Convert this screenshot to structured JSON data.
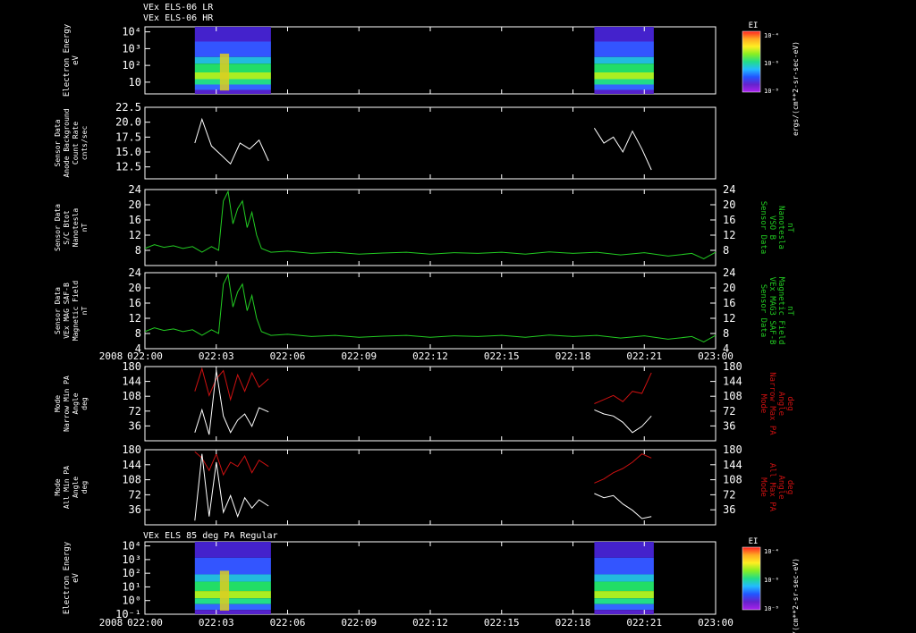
{
  "header": {
    "line1": "VEx ELS-06 LR",
    "line2": "VEx ELS-06 HR"
  },
  "bottom_header": "VEx ELS 85 deg PA Regular",
  "year_label": "2008",
  "time_ticks": [
    "022:00",
    "022:03",
    "022:06",
    "022:09",
    "022:12",
    "022:15",
    "022:18",
    "022:21",
    "023:00"
  ],
  "colors": {
    "background": "#000000",
    "frame": "#ffffff",
    "green": "#22cc22",
    "red": "#cc1111",
    "white": "#ffffff"
  },
  "colorbar": {
    "label": "EI",
    "ticks": [
      "10⁻⁴",
      "10⁻⁶",
      "10⁻⁸"
    ],
    "unit": "ergs/(cm**2-sr-sec-eV)"
  },
  "chart_data": [
    {
      "type": "heatmap",
      "id": "spec1",
      "ylabel": [
        "Electron Energy",
        "eV"
      ],
      "yscale": "log",
      "yticks": [
        "10⁴",
        "10³",
        "10²",
        "10"
      ],
      "ytick_values": [
        10000,
        1000,
        100,
        10
      ],
      "ylim": [
        2,
        20000
      ],
      "xlim": [
        0,
        8
      ],
      "segments": [
        {
          "x": [
            2.1,
            5.3
          ]
        },
        {
          "x": [
            18.9,
            21.4
          ]
        }
      ],
      "legend": "colorbar right"
    },
    {
      "type": "line",
      "id": "bkg",
      "ylabel": [
        "Sensor Data",
        "Anode Background",
        "Count Rate",
        "cnts/sec"
      ],
      "yticks": [
        "22.5",
        "20.0",
        "17.5",
        "15.0",
        "12.5"
      ],
      "ytick_values": [
        22.5,
        20.0,
        17.5,
        15.0,
        12.5
      ],
      "ylim": [
        10.5,
        22.5
      ],
      "xlim": [
        0,
        8
      ],
      "series": [
        {
          "color": "#ffffff",
          "segments": [
            {
              "x": [
                2.1,
                2.4,
                2.8,
                3.2,
                3.6,
                4.0,
                4.4,
                4.8,
                5.2
              ],
              "y": [
                16.5,
                20.5,
                16.0,
                14.5,
                13.0,
                16.5,
                15.5,
                17.0,
                13.5
              ]
            },
            {
              "x": [
                18.9,
                19.3,
                19.7,
                20.1,
                20.5,
                20.9,
                21.3
              ],
              "y": [
                19.0,
                16.5,
                17.5,
                15.0,
                18.5,
                15.5,
                12.0
              ]
            }
          ]
        }
      ]
    },
    {
      "type": "line",
      "id": "bmag",
      "ylabel": [
        "Sensor Data",
        "S/C Btot",
        "Nanotesla",
        "nT"
      ],
      "ylabel_right": [
        "Sensor Data",
        "VSO B",
        "Nanotesla",
        "nT"
      ],
      "yticks": [
        "24",
        "20",
        "16",
        "12",
        "8"
      ],
      "ytick_values": [
        24,
        20,
        16,
        12,
        8
      ],
      "ylim": [
        4,
        24
      ],
      "xlim": [
        0,
        8
      ],
      "series": [
        {
          "color": "#22cc22",
          "segments": [
            {
              "x": [
                0,
                0.4,
                0.8,
                1.2,
                1.6,
                2.0,
                2.4,
                2.8,
                3.1,
                3.3,
                3.5,
                3.7,
                3.9,
                4.1,
                4.3,
                4.5,
                4.7,
                4.9,
                5.3,
                6,
                7,
                8,
                9,
                10,
                11,
                12,
                13,
                14,
                15,
                16,
                17,
                18,
                19,
                20,
                21,
                22,
                23,
                23.5,
                24
              ],
              "y": [
                8.5,
                9.5,
                8.8,
                9.2,
                8.5,
                9.0,
                7.5,
                9.0,
                8.0,
                21.0,
                23.5,
                15.0,
                19.0,
                21.0,
                14.0,
                18.0,
                12.0,
                8.5,
                7.5,
                7.8,
                7.2,
                7.5,
                7.0,
                7.3,
                7.5,
                7.0,
                7.4,
                7.2,
                7.5,
                7.0,
                7.6,
                7.2,
                7.5,
                6.8,
                7.4,
                6.5,
                7.2,
                5.8,
                7.5
              ]
            }
          ]
        }
      ]
    },
    {
      "type": "line",
      "id": "bsaf",
      "ylabel": [
        "Sensor Data",
        "VEx MAG SAF-B",
        "Magnetic Field",
        "nT"
      ],
      "ylabel_right": [
        "Sensor Data",
        "VEx MAG3 SAF-B",
        "Magnetic Field",
        "nT"
      ],
      "yticks": [
        "24",
        "20",
        "16",
        "12",
        "8",
        "4"
      ],
      "ytick_values": [
        24,
        20,
        16,
        12,
        8,
        4
      ],
      "ylim": [
        4,
        24
      ],
      "xlim": [
        0,
        8
      ],
      "series": [
        {
          "color": "#22cc22",
          "segments": [
            {
              "x": [
                0,
                0.4,
                0.8,
                1.2,
                1.6,
                2.0,
                2.4,
                2.8,
                3.1,
                3.3,
                3.5,
                3.7,
                3.9,
                4.1,
                4.3,
                4.5,
                4.7,
                4.9,
                5.3,
                6,
                7,
                8,
                9,
                10,
                11,
                12,
                13,
                14,
                15,
                16,
                17,
                18,
                19,
                20,
                21,
                22,
                23,
                23.5,
                24
              ],
              "y": [
                8.5,
                9.5,
                8.8,
                9.2,
                8.5,
                9.0,
                7.5,
                9.0,
                8.0,
                21.0,
                23.5,
                15.0,
                19.0,
                21.0,
                14.0,
                18.0,
                12.0,
                8.5,
                7.5,
                7.8,
                7.2,
                7.5,
                7.0,
                7.3,
                7.5,
                7.0,
                7.4,
                7.2,
                7.5,
                7.0,
                7.6,
                7.2,
                7.5,
                6.8,
                7.4,
                6.5,
                7.2,
                5.8,
                7.5
              ]
            }
          ]
        }
      ]
    },
    {
      "type": "line",
      "id": "pa_narrow",
      "ylabel": [
        "Mode",
        "Narrow Min PA",
        "Angle",
        "deg"
      ],
      "ylabel_right": [
        "Mode",
        "Narrow Max PA",
        "Angle",
        "deg"
      ],
      "yticks": [
        "180",
        "144",
        "108",
        "72",
        "36"
      ],
      "ytick_values": [
        180,
        144,
        108,
        72,
        36
      ],
      "ylim": [
        0,
        180
      ],
      "xlim": [
        0,
        8
      ],
      "series": [
        {
          "color": "#cc1111",
          "segments": [
            {
              "x": [
                2.1,
                2.4,
                2.7,
                3.0,
                3.3,
                3.6,
                3.9,
                4.2,
                4.5,
                4.8,
                5.2
              ],
              "y": [
                120,
                175,
                110,
                150,
                170,
                100,
                160,
                120,
                165,
                130,
                150
              ]
            },
            {
              "x": [
                18.9,
                19.3,
                19.7,
                20.1,
                20.5,
                20.9,
                21.3
              ],
              "y": [
                90,
                100,
                110,
                95,
                120,
                115,
                165
              ]
            }
          ]
        },
        {
          "color": "#ffffff",
          "segments": [
            {
              "x": [
                2.1,
                2.4,
                2.7,
                3.0,
                3.3,
                3.6,
                3.9,
                4.2,
                4.5,
                4.8,
                5.2
              ],
              "y": [
                20,
                75,
                15,
                170,
                60,
                20,
                50,
                65,
                35,
                80,
                70
              ]
            },
            {
              "x": [
                18.9,
                19.3,
                19.7,
                20.1,
                20.5,
                20.9,
                21.3
              ],
              "y": [
                75,
                65,
                60,
                45,
                20,
                35,
                60
              ]
            }
          ]
        }
      ]
    },
    {
      "type": "line",
      "id": "pa_all",
      "ylabel": [
        "Mode",
        "All Min PA",
        "Angle",
        "deg"
      ],
      "ylabel_right": [
        "Mode",
        "All Max PA",
        "Angle",
        "deg"
      ],
      "yticks": [
        "180",
        "144",
        "108",
        "72",
        "36"
      ],
      "ytick_values": [
        180,
        144,
        108,
        72,
        36
      ],
      "ylim": [
        0,
        180
      ],
      "xlim": [
        0,
        8
      ],
      "series": [
        {
          "color": "#cc1111",
          "segments": [
            {
              "x": [
                2.1,
                2.4,
                2.7,
                3.0,
                3.3,
                3.6,
                3.9,
                4.2,
                4.5,
                4.8,
                5.2
              ],
              "y": [
                175,
                160,
                130,
                170,
                120,
                150,
                140,
                165,
                125,
                155,
                140
              ]
            },
            {
              "x": [
                18.9,
                19.3,
                19.7,
                20.1,
                20.5,
                20.9,
                21.3
              ],
              "y": [
                100,
                110,
                125,
                135,
                150,
                170,
                160
              ]
            }
          ]
        },
        {
          "color": "#ffffff",
          "segments": [
            {
              "x": [
                2.1,
                2.4,
                2.7,
                3.0,
                3.3,
                3.6,
                3.9,
                4.2,
                4.5,
                4.8,
                5.2
              ],
              "y": [
                10,
                170,
                20,
                150,
                30,
                70,
                20,
                65,
                40,
                60,
                45
              ]
            },
            {
              "x": [
                18.9,
                19.3,
                19.7,
                20.1,
                20.5,
                20.9,
                21.3
              ],
              "y": [
                75,
                65,
                70,
                50,
                35,
                15,
                20
              ]
            }
          ]
        }
      ]
    },
    {
      "type": "heatmap",
      "id": "spec2",
      "ylabel": [
        "Electron Energy",
        "eV"
      ],
      "yscale": "log",
      "yticks": [
        "10⁴",
        "10³",
        "10²",
        "10¹",
        "10⁰",
        "10⁻¹"
      ],
      "ytick_values": [
        10000,
        1000,
        100,
        10,
        1,
        0.1
      ],
      "ylim": [
        0.1,
        20000
      ],
      "xlim": [
        0,
        8
      ],
      "segments": [
        {
          "x": [
            2.1,
            5.3
          ]
        },
        {
          "x": [
            18.9,
            21.4
          ]
        }
      ],
      "legend": "colorbar right"
    }
  ]
}
